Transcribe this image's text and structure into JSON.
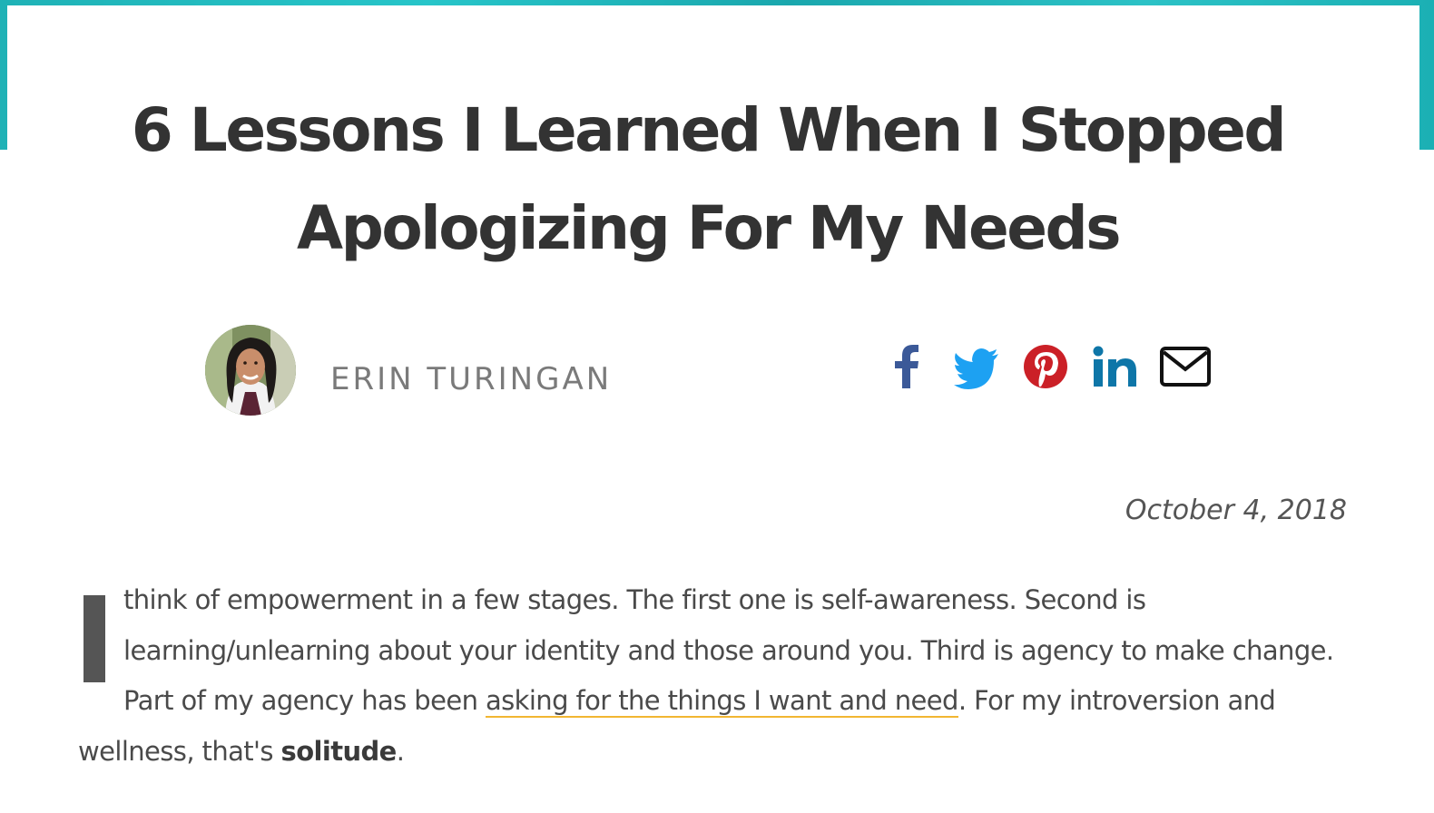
{
  "article": {
    "title": "6 Lessons I Learned When I Stopped Apologizing For My Needs",
    "author": "ERIN TURINGAN",
    "date": "October 4, 2018",
    "dropcap": "I",
    "paragraph": {
      "part1": " think of empowerment in a few stages. The first one is self-awareness. Second is learning/unlearning about your identity and those around you. Third is agency to make change. Part of my agency has been ",
      "link_text": "asking for the things I want and need",
      "part2": ". For my introversion and wellness, that's ",
      "bold": "solitude",
      "part3": "."
    }
  },
  "share": [
    {
      "icon": "facebook-icon",
      "color": "#3b5998"
    },
    {
      "icon": "twitter-icon",
      "color": "#1da1f2"
    },
    {
      "icon": "pinterest-icon",
      "color": "#cb2027"
    },
    {
      "icon": "linkedin-icon",
      "color": "#0e76a8"
    },
    {
      "icon": "email-icon",
      "color": "#111111"
    }
  ],
  "theme": {
    "frame_color": "#1fb2b6",
    "link_underline": "#f2b632",
    "text_color": "#333333"
  }
}
